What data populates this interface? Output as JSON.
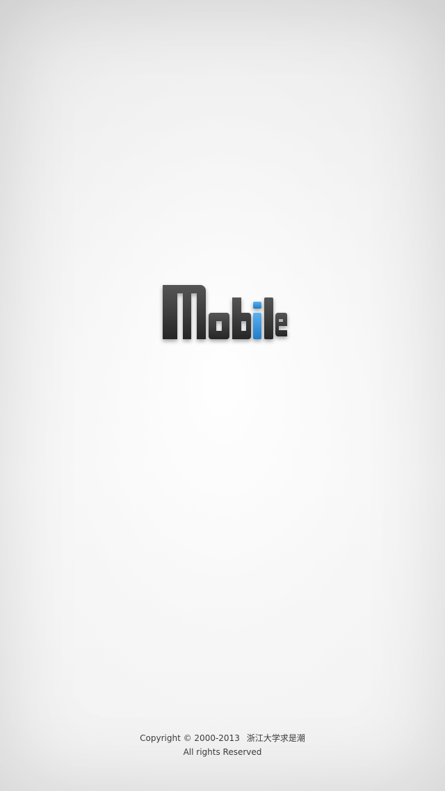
{
  "splash": {
    "logo_text": "Mobile",
    "logo_color": "#3a3a3a",
    "logo_accent_color": "#2f8fdc"
  },
  "footer": {
    "copyright": "Copyright © 2000-2013",
    "organization": "浙江大学求是潮",
    "rights": "All rights Reserved"
  }
}
